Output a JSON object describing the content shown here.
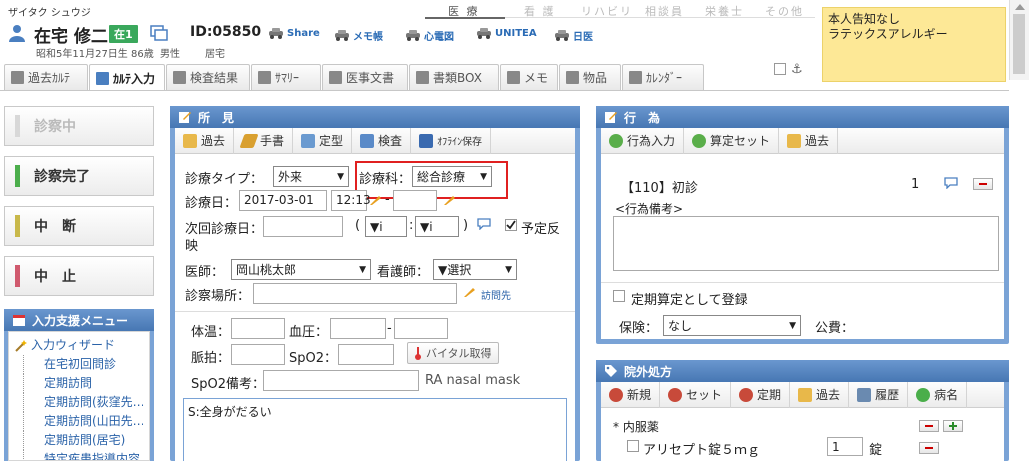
{
  "patient": {
    "kana": "ザイタク シュウジ",
    "name": "在宅 修二",
    "status_badge": "在1",
    "id": "ID:05850",
    "dob_age": "昭和5年11月27日生 86歳",
    "gender": "男性",
    "residence": "居宅"
  },
  "toolbar_links": [
    "Share",
    "メモ帳",
    "心電図",
    "UNITEA",
    "日医"
  ],
  "roles": [
    "医 療",
    "看 護",
    "リハビリ",
    "相談員",
    "栄養士",
    "その他"
  ],
  "note": "本人告知なし\nラテックスアレルギー",
  "tabs": [
    "過去ｶﾙﾃ",
    "ｶﾙﾃ入力",
    "検査結果",
    "ｻﾏﾘｰ",
    "医事文書",
    "書類BOX",
    "メモ",
    "物品",
    "ｶﾚﾝﾀﾞｰ"
  ],
  "status_buttons": [
    "診察中",
    "診察完了",
    "中　断",
    "中　止"
  ],
  "status_colors": [
    "#d0d0d0",
    "#4cae4c",
    "#c8b84a",
    "#d05a6e"
  ],
  "support_menu": {
    "title": "入力支援メニュー",
    "wizard": "入力ウィザード",
    "items": [
      "在宅初回問診",
      "定期訪問",
      "定期訪問(荻窪先…",
      "定期訪問(山田先…",
      "定期訪問(居宅)",
      "特定疾患指導内容"
    ]
  },
  "findings": {
    "title": "所　見",
    "toolbar": [
      "過去",
      "手書",
      "定型",
      "検査",
      "ｵﾌﾗｲﾝ保存"
    ],
    "visit_type_label": "診療タイプ：",
    "visit_type_value": "外来",
    "dept_label": "診療科：",
    "dept_value": "総合診療",
    "date_label": "診療日：",
    "date_value": "2017-03-01",
    "time_value": "12:13",
    "next_date_label": "次回診療日：",
    "paren_open": "(",
    "paren_close": ")",
    "sel_a": "▼i",
    "sel_b": "▼i",
    "colon": ":",
    "dash": "-",
    "reflect_label": "予定反",
    "reflect_label2": "映",
    "doctor_label": "医師：",
    "doctor_value": "岡山桃太郎",
    "nurse_label": "看護師：",
    "nurse_value": "▼選択",
    "place_label": "診察場所：",
    "visit_link": "訪問先",
    "temp_label": "体温：",
    "bp_label": "血圧：",
    "pulse_label": "脈拍：",
    "spo2_label": "SpO2：",
    "vital_button": "バイタル取得",
    "spo2_note_label": "SpO2備考：",
    "spo2_note_value": "RA nasal mask",
    "soap_text": "S:全身がだるい"
  },
  "actions": {
    "title": "行　為",
    "toolbar": [
      "行為入力",
      "算定セット",
      "過去"
    ],
    "item": "【110】初診",
    "item_count": "1",
    "remark_label": "<行為備考>",
    "periodic_label": "定期算定として登録",
    "insurance_label": "保険：",
    "insurance_value": "なし",
    "public_label": "公費："
  },
  "prescription": {
    "title": "院外処方",
    "toolbar": [
      "新規",
      "セット",
      "定期",
      "過去",
      "履歴",
      "病名"
    ],
    "category": "* 内服薬",
    "drug": "アリセプト錠５ｍｇ",
    "qty": "1",
    "unit": "錠"
  }
}
